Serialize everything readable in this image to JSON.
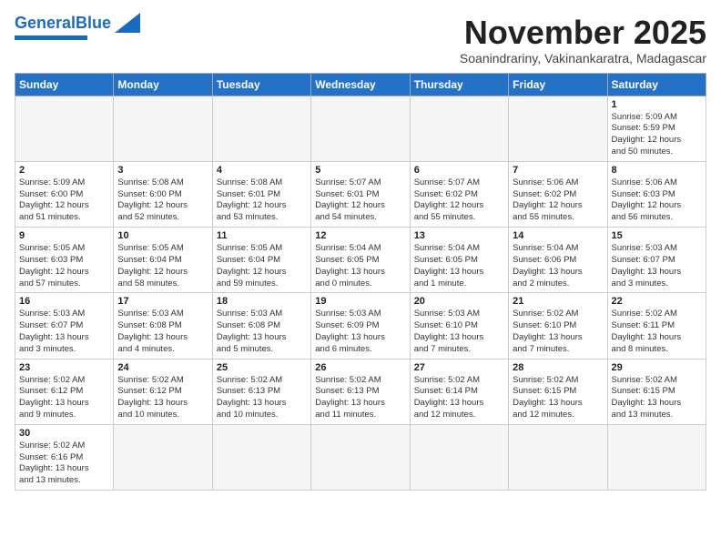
{
  "header": {
    "logo_general": "General",
    "logo_blue": "Blue",
    "month_title": "November 2025",
    "subtitle": "Soanindrariny, Vakinankaratra, Madagascar"
  },
  "days_of_week": [
    "Sunday",
    "Monday",
    "Tuesday",
    "Wednesday",
    "Thursday",
    "Friday",
    "Saturday"
  ],
  "weeks": [
    [
      {
        "day": "",
        "info": ""
      },
      {
        "day": "",
        "info": ""
      },
      {
        "day": "",
        "info": ""
      },
      {
        "day": "",
        "info": ""
      },
      {
        "day": "",
        "info": ""
      },
      {
        "day": "",
        "info": ""
      },
      {
        "day": "1",
        "info": "Sunrise: 5:09 AM\nSunset: 5:59 PM\nDaylight: 12 hours\nand 50 minutes."
      }
    ],
    [
      {
        "day": "2",
        "info": "Sunrise: 5:09 AM\nSunset: 6:00 PM\nDaylight: 12 hours\nand 51 minutes."
      },
      {
        "day": "3",
        "info": "Sunrise: 5:08 AM\nSunset: 6:00 PM\nDaylight: 12 hours\nand 52 minutes."
      },
      {
        "day": "4",
        "info": "Sunrise: 5:08 AM\nSunset: 6:01 PM\nDaylight: 12 hours\nand 53 minutes."
      },
      {
        "day": "5",
        "info": "Sunrise: 5:07 AM\nSunset: 6:01 PM\nDaylight: 12 hours\nand 54 minutes."
      },
      {
        "day": "6",
        "info": "Sunrise: 5:07 AM\nSunset: 6:02 PM\nDaylight: 12 hours\nand 55 minutes."
      },
      {
        "day": "7",
        "info": "Sunrise: 5:06 AM\nSunset: 6:02 PM\nDaylight: 12 hours\nand 55 minutes."
      },
      {
        "day": "8",
        "info": "Sunrise: 5:06 AM\nSunset: 6:03 PM\nDaylight: 12 hours\nand 56 minutes."
      }
    ],
    [
      {
        "day": "9",
        "info": "Sunrise: 5:05 AM\nSunset: 6:03 PM\nDaylight: 12 hours\nand 57 minutes."
      },
      {
        "day": "10",
        "info": "Sunrise: 5:05 AM\nSunset: 6:04 PM\nDaylight: 12 hours\nand 58 minutes."
      },
      {
        "day": "11",
        "info": "Sunrise: 5:05 AM\nSunset: 6:04 PM\nDaylight: 12 hours\nand 59 minutes."
      },
      {
        "day": "12",
        "info": "Sunrise: 5:04 AM\nSunset: 6:05 PM\nDaylight: 13 hours\nand 0 minutes."
      },
      {
        "day": "13",
        "info": "Sunrise: 5:04 AM\nSunset: 6:05 PM\nDaylight: 13 hours\nand 1 minute."
      },
      {
        "day": "14",
        "info": "Sunrise: 5:04 AM\nSunset: 6:06 PM\nDaylight: 13 hours\nand 2 minutes."
      },
      {
        "day": "15",
        "info": "Sunrise: 5:03 AM\nSunset: 6:07 PM\nDaylight: 13 hours\nand 3 minutes."
      }
    ],
    [
      {
        "day": "16",
        "info": "Sunrise: 5:03 AM\nSunset: 6:07 PM\nDaylight: 13 hours\nand 3 minutes."
      },
      {
        "day": "17",
        "info": "Sunrise: 5:03 AM\nSunset: 6:08 PM\nDaylight: 13 hours\nand 4 minutes."
      },
      {
        "day": "18",
        "info": "Sunrise: 5:03 AM\nSunset: 6:08 PM\nDaylight: 13 hours\nand 5 minutes."
      },
      {
        "day": "19",
        "info": "Sunrise: 5:03 AM\nSunset: 6:09 PM\nDaylight: 13 hours\nand 6 minutes."
      },
      {
        "day": "20",
        "info": "Sunrise: 5:03 AM\nSunset: 6:10 PM\nDaylight: 13 hours\nand 7 minutes."
      },
      {
        "day": "21",
        "info": "Sunrise: 5:02 AM\nSunset: 6:10 PM\nDaylight: 13 hours\nand 7 minutes."
      },
      {
        "day": "22",
        "info": "Sunrise: 5:02 AM\nSunset: 6:11 PM\nDaylight: 13 hours\nand 8 minutes."
      }
    ],
    [
      {
        "day": "23",
        "info": "Sunrise: 5:02 AM\nSunset: 6:12 PM\nDaylight: 13 hours\nand 9 minutes."
      },
      {
        "day": "24",
        "info": "Sunrise: 5:02 AM\nSunset: 6:12 PM\nDaylight: 13 hours\nand 10 minutes."
      },
      {
        "day": "25",
        "info": "Sunrise: 5:02 AM\nSunset: 6:13 PM\nDaylight: 13 hours\nand 10 minutes."
      },
      {
        "day": "26",
        "info": "Sunrise: 5:02 AM\nSunset: 6:13 PM\nDaylight: 13 hours\nand 11 minutes."
      },
      {
        "day": "27",
        "info": "Sunrise: 5:02 AM\nSunset: 6:14 PM\nDaylight: 13 hours\nand 12 minutes."
      },
      {
        "day": "28",
        "info": "Sunrise: 5:02 AM\nSunset: 6:15 PM\nDaylight: 13 hours\nand 12 minutes."
      },
      {
        "day": "29",
        "info": "Sunrise: 5:02 AM\nSunset: 6:15 PM\nDaylight: 13 hours\nand 13 minutes."
      }
    ],
    [
      {
        "day": "30",
        "info": "Sunrise: 5:02 AM\nSunset: 6:16 PM\nDaylight: 13 hours\nand 13 minutes."
      },
      {
        "day": "",
        "info": ""
      },
      {
        "day": "",
        "info": ""
      },
      {
        "day": "",
        "info": ""
      },
      {
        "day": "",
        "info": ""
      },
      {
        "day": "",
        "info": ""
      },
      {
        "day": "",
        "info": ""
      }
    ]
  ]
}
